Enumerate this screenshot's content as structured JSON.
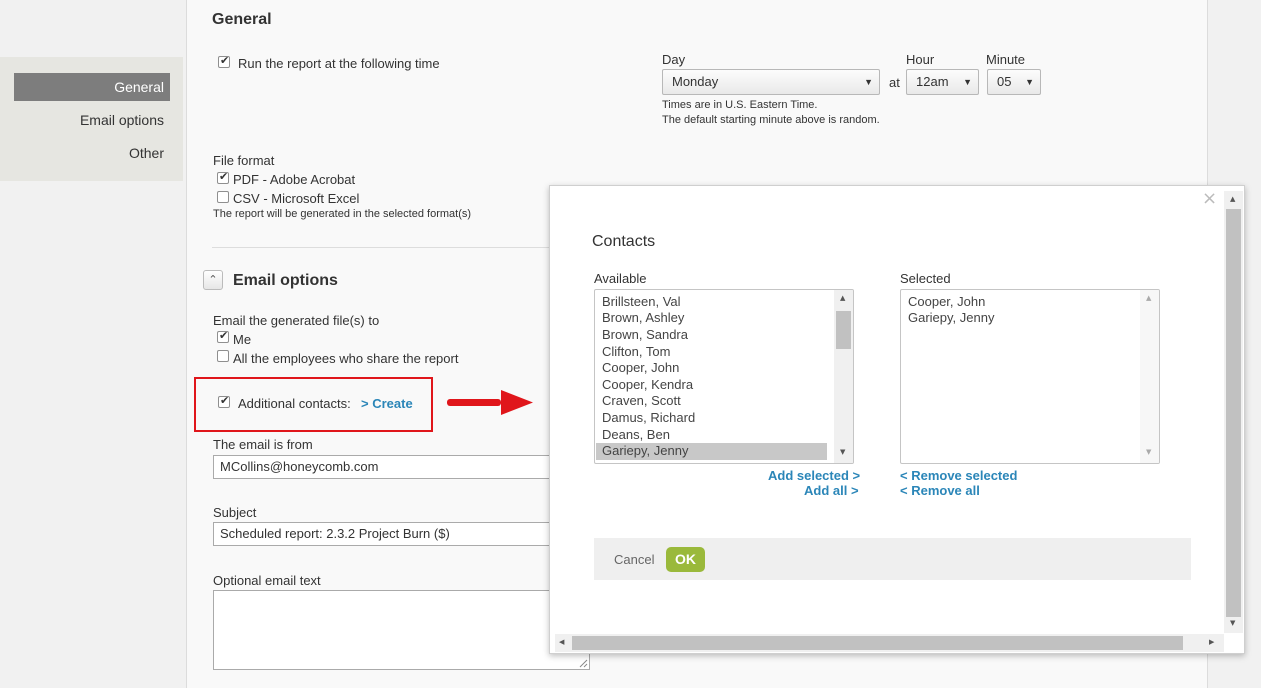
{
  "sidebar": {
    "items": [
      {
        "label": "General",
        "active": true
      },
      {
        "label": "Email options",
        "active": false
      },
      {
        "label": "Other",
        "active": false
      }
    ]
  },
  "general": {
    "title": "General",
    "run_report_label": "Run the report at the following time",
    "day_label": "Day",
    "day_value": "Monday",
    "at_label": "at",
    "hour_label": "Hour",
    "hour_value": "12am",
    "minute_label": "Minute",
    "minute_value": "05",
    "time_note_1": "Times are in U.S. Eastern Time.",
    "time_note_2": "The default starting minute above is random.",
    "file_format_label": "File format",
    "format_pdf": "PDF - Adobe Acrobat",
    "format_csv": "CSV - Microsoft Excel",
    "format_note": "The report will be generated in the selected format(s)"
  },
  "email_options": {
    "title": "Email options",
    "email_to_label": "Email the generated file(s) to",
    "me_label": "Me",
    "all_employees_label": "All the employees who share the report",
    "additional_contacts_label": "Additional contacts:",
    "create_link": "> Create",
    "from_label": "The email is from",
    "from_value": "MCollins@honeycomb.com",
    "subject_label": "Subject",
    "subject_value": "Scheduled report: 2.3.2 Project Burn ($)",
    "optional_text_label": "Optional email text"
  },
  "modal": {
    "title": "Contacts",
    "close_icon": "×",
    "available_label": "Available",
    "selected_label": "Selected",
    "available": [
      "Brillsteen, Val",
      "Brown, Ashley",
      "Brown, Sandra",
      "Clifton, Tom",
      "Cooper, John",
      "Cooper, Kendra",
      "Craven, Scott",
      "Damus, Richard",
      "Deans, Ben",
      "Gariepy, Jenny"
    ],
    "selected": [
      "Cooper, John",
      "Gariepy, Jenny"
    ],
    "add_selected": "Add selected >",
    "add_all": "Add all >",
    "remove_selected": "< Remove selected",
    "remove_all": "< Remove all",
    "cancel": "Cancel",
    "ok": "OK"
  },
  "colors": {
    "link": "#2b86b8",
    "ok_button": "#9ab93b",
    "annotation_red": "#e0161b",
    "sidebar_active": "#7d7d7d"
  }
}
